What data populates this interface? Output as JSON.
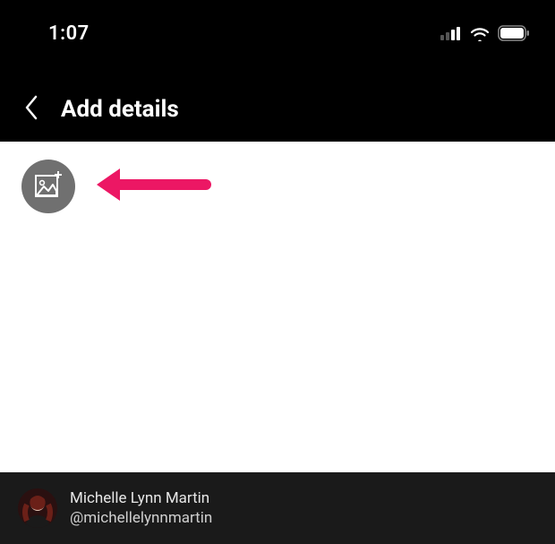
{
  "status": {
    "time": "1:07"
  },
  "header": {
    "title": "Add details"
  },
  "footer": {
    "name": "Michelle Lynn Martin",
    "handle": "@michellelynnmartin"
  }
}
